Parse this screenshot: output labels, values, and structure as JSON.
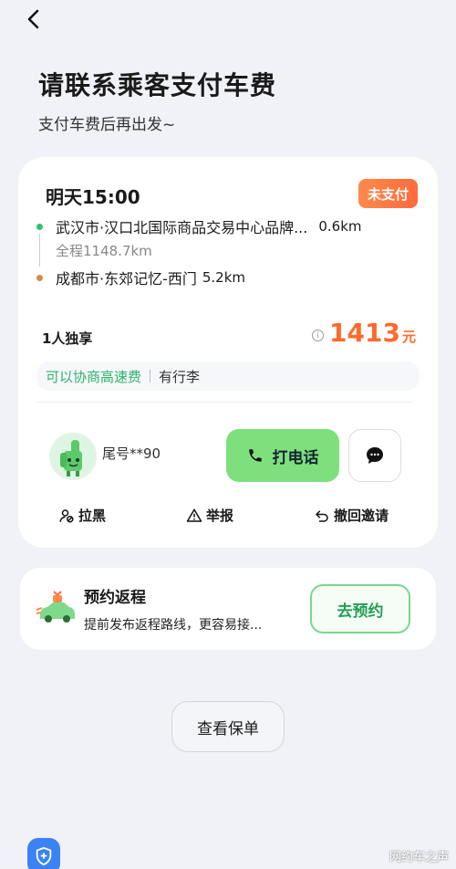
{
  "header": {
    "title": "请联系乘客支付车费",
    "subtitle": "支付车费后再出发~"
  },
  "trip": {
    "depart_time": "明天15:00",
    "status_badge": "未支付",
    "origin": {
      "text": "武汉市·汉口北国际商品交易中心品牌...",
      "distance": "0.6km"
    },
    "total_distance": "全程1148.7km",
    "destination": {
      "text": "成都市·东郊记忆-西门",
      "distance": "5.2km"
    },
    "seat_type": "1人独享",
    "fare_info_icon": "i",
    "fare_amount": "1413",
    "fare_unit": "元",
    "tags": {
      "highway": "可以协商高速费",
      "luggage": "有行李"
    }
  },
  "passenger": {
    "tail_number": "尾号**90",
    "call_label": "打电话"
  },
  "actions": {
    "block_label": "拉黑",
    "report_label": "举报",
    "withdraw_label": "撤回邀请"
  },
  "return_trip": {
    "title": "预约返程",
    "description": "提前发布返程路线，更容易接...",
    "button_label": "去预约"
  },
  "policy_button_label": "查看保单",
  "watermark": "网约车之声",
  "colors": {
    "accent_green": "#7ee07d",
    "badge_orange": "#ff6a3d",
    "fare_orange": "#ff6a2c",
    "origin_dot": "#2fc56a",
    "destination_dot": "#e0864a",
    "safety_blue": "#3b82f6"
  },
  "icons": {
    "back": "chevron-left-icon",
    "phone": "phone-icon",
    "chat": "chat-bubble-icon",
    "block": "user-block-icon",
    "report": "warning-triangle-icon",
    "withdraw": "undo-arrow-icon",
    "safety": "shield-plus-icon"
  }
}
